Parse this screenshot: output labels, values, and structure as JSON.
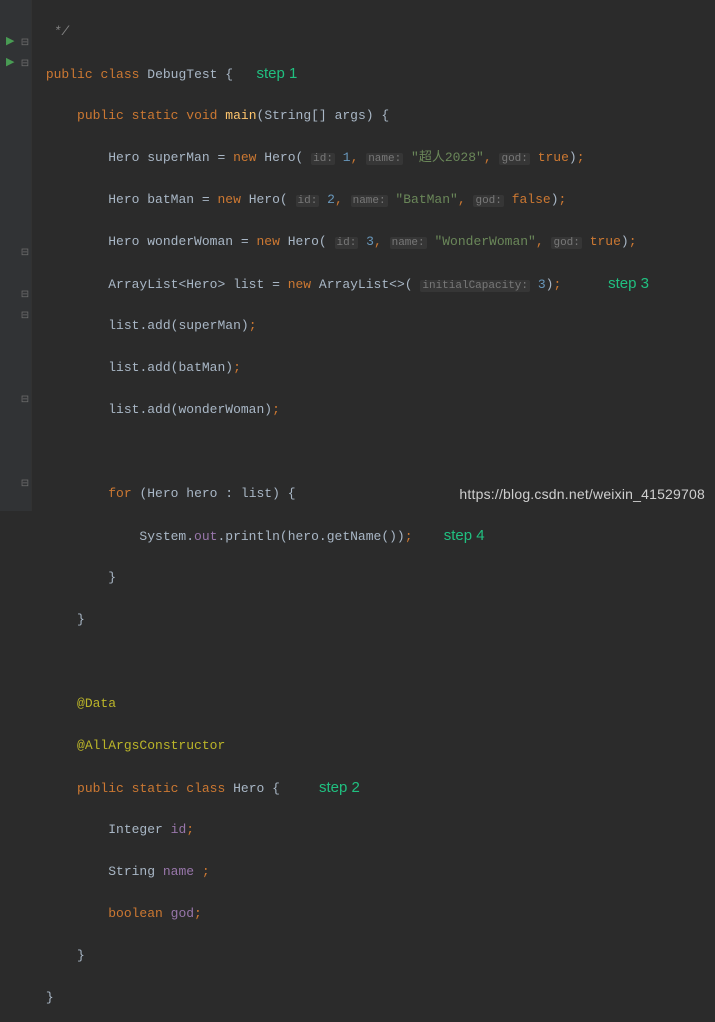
{
  "comment_close": "*/",
  "class_decl": {
    "public": "public",
    "class": "class",
    "name": "DebugTest",
    "brace": "{"
  },
  "main_decl": {
    "public": "public",
    "static": "static",
    "void": "void",
    "main": "main",
    "args_type": "String[]",
    "args_name": "args"
  },
  "line_superman": {
    "type": "Hero",
    "var": "superMan",
    "new": "new",
    "ctor": "Hero",
    "id_hint": "id:",
    "id": "1",
    "name_hint": "name:",
    "name": "\"超人2028\"",
    "god_hint": "god:",
    "god": "true"
  },
  "line_batman": {
    "type": "Hero",
    "var": "batMan",
    "new": "new",
    "ctor": "Hero",
    "id_hint": "id:",
    "id": "2",
    "name_hint": "name:",
    "name": "\"BatMan\"",
    "god_hint": "god:",
    "god": "false"
  },
  "line_wonder": {
    "type": "Hero",
    "var": "wonderWoman",
    "new": "new",
    "ctor": "Hero",
    "id_hint": "id:",
    "id": "3",
    "name_hint": "name:",
    "name": "\"WonderWoman\"",
    "god_hint": "god:",
    "god": "true"
  },
  "line_list_decl": {
    "type": "ArrayList",
    "generic": "Hero",
    "var": "list",
    "new": "new",
    "ctor": "ArrayList",
    "cap_hint": "initialCapacity:",
    "cap": "3"
  },
  "line_add1": {
    "obj": "list",
    "mtd": "add",
    "arg": "superMan"
  },
  "line_add2": {
    "obj": "list",
    "mtd": "add",
    "arg": "batMan"
  },
  "line_add3": {
    "obj": "list",
    "mtd": "add",
    "arg": "wonderWoman"
  },
  "for_line": {
    "for": "for",
    "type": "Hero",
    "var": "hero",
    "coll": "list"
  },
  "println_line": {
    "cls": "System",
    "out": "out",
    "mtd": "println",
    "arg": "hero",
    "get": "getName"
  },
  "ann_data": "@Data",
  "ann_ctor": "@AllArgsConstructor",
  "hero_decl": {
    "public": "public",
    "static": "static",
    "class": "class",
    "name": "Hero"
  },
  "field_id": {
    "type": "Integer",
    "name": "id"
  },
  "field_name": {
    "type": "String",
    "name": "name"
  },
  "field_god": {
    "type": "boolean",
    "name": "god"
  },
  "steps": {
    "s1": "step 1",
    "s2": "step 2",
    "s3": "step 3",
    "s4": "step 4"
  },
  "watermark": "https://blog.csdn.net/weixin_41529708"
}
